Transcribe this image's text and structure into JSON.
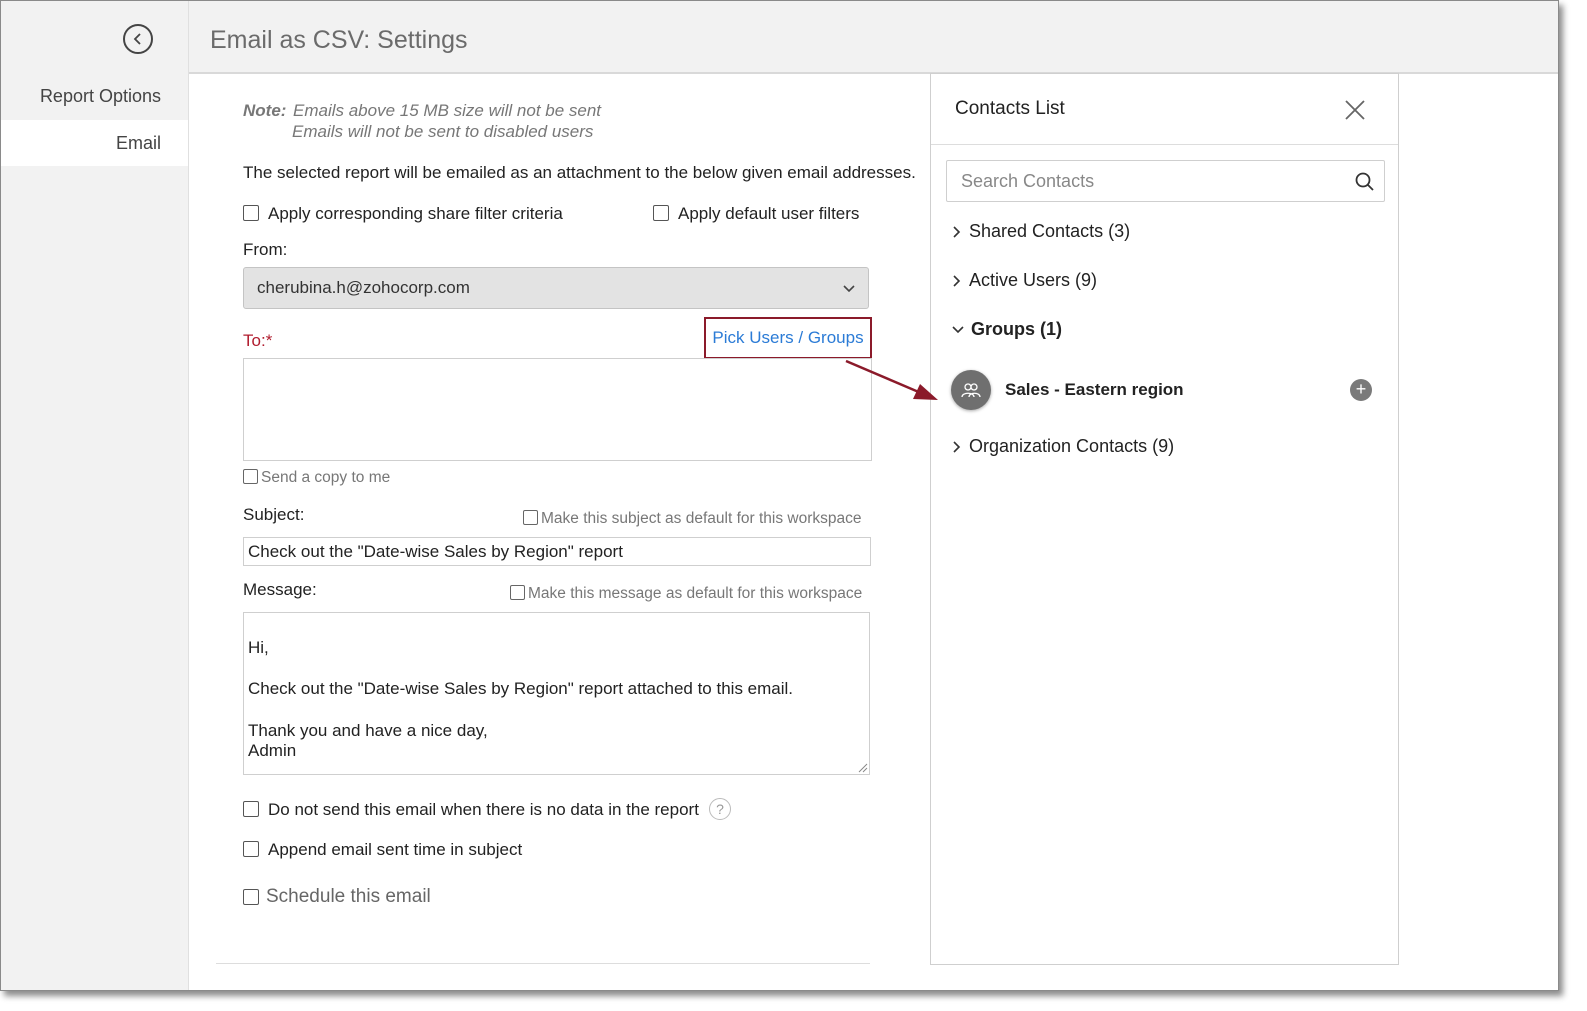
{
  "header": {
    "title": "Email as CSV: Settings"
  },
  "sidebar": {
    "items": [
      {
        "label": "Report Options"
      },
      {
        "label": "Email"
      }
    ]
  },
  "note": {
    "label": "Note:",
    "line1": "Emails above 15 MB size will not be sent",
    "line2": "Emails will not be sent to disabled users"
  },
  "description": "The selected report will be emailed as an attachment to the below given email addresses.",
  "filters": {
    "share_filter_label": "Apply corresponding share filter criteria",
    "user_filter_label": "Apply default user filters"
  },
  "from": {
    "label": "From:",
    "value": "cherubina.h@zohocorp.com"
  },
  "to": {
    "label": "To:",
    "required_mark": "*",
    "pick_link": "Pick Users / Groups",
    "value": ""
  },
  "send_copy_label": "Send a copy to me",
  "subject": {
    "label": "Subject:",
    "default_label": "Make this subject as default for this workspace",
    "value": "Check out the \"Date-wise Sales by Region\" report"
  },
  "message": {
    "label": "Message:",
    "default_label": "Make this message as default for this workspace",
    "value": "Hi,\n\nCheck out the \"Date-wise Sales by Region\" report attached to this email.\n\nThank you and have a nice day,\nAdmin"
  },
  "options": {
    "no_data_label": "Do not send this email when there is no data in the report",
    "help_icon": "?",
    "append_time_label": "Append email sent time in subject",
    "schedule_label": "Schedule this email"
  },
  "contacts_panel": {
    "title": "Contacts List",
    "search_placeholder": "Search Contacts",
    "sections": [
      {
        "label": "Shared Contacts (3)",
        "expanded": false
      },
      {
        "label": "Active Users (9)",
        "expanded": false
      },
      {
        "label": "Groups (1)",
        "expanded": true
      },
      {
        "label": "Organization Contacts (9)",
        "expanded": false
      }
    ],
    "groups": [
      {
        "name": "Sales - Eastern region"
      }
    ]
  },
  "colors": {
    "accent_red": "#8b1a2a",
    "link_blue": "#2b7bd6",
    "required_red": "#b01c2e"
  }
}
